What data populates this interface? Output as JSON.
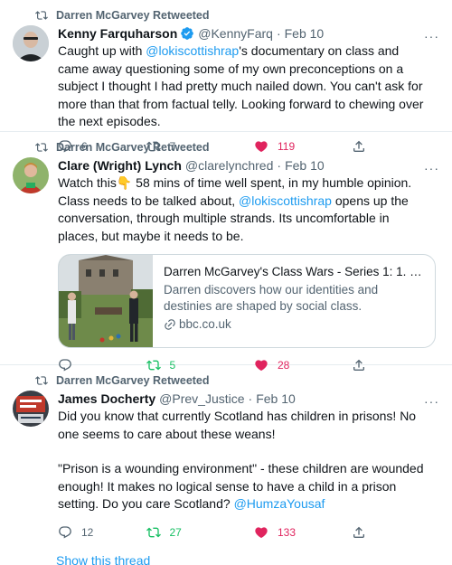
{
  "tweets": [
    {
      "retweet_label": "Darren McGarvey Retweeted",
      "name": "Kenny Farquharson",
      "handle": "@KennyFarq",
      "sep": "·",
      "date": "Feb 10",
      "more": "···",
      "text_a": "Caught up with ",
      "mention": "@lokiscottishrap",
      "text_b": "'s documentary on class and came away questioning some of my own preconceptions on a subject I thought I had pretty much nailed down. You can't ask for more than that from factual telly. Looking forward to chewing over the next episodes.",
      "replies": "6",
      "retweets": "7",
      "likes": "119"
    },
    {
      "retweet_label": "Darren McGarvey Retweeted",
      "name": "Clare (Wright) Lynch",
      "handle": "@clarelynchred",
      "sep": "·",
      "date": "Feb 10",
      "more": "···",
      "text_a": "Watch this👇 58 mins of time well spent, in my humble opinion. Class needs to be talked about, ",
      "mention": "@lokiscottishrap",
      "text_b": " opens up the conversation, through multiple strands. Its uncomfortable in places, but maybe it needs to be.",
      "card": {
        "title": "Darren McGarvey's Class Wars - Series 1: 1. Identi...",
        "description": "Darren discovers how our identities and destinies are shaped by social class.",
        "domain": "bbc.co.uk"
      },
      "retweets": "5",
      "likes": "28"
    },
    {
      "retweet_label": "Darren McGarvey Retweeted",
      "name": "James Docherty",
      "handle": "@Prev_Justice",
      "sep": "·",
      "date": "Feb 10",
      "more": "···",
      "text_p1": "Did you know that currently Scotland has children in prisons! No one seems to care about these weans!",
      "text_p2": "\"Prison is a wounding environment\" - these children are wounded enough! It makes no logical sense to have a child in a prison setting. Do you care Scotland? ",
      "mention": "@HumzaYousaf",
      "replies": "12",
      "retweets": "27",
      "likes": "133",
      "show_thread": "Show this thread"
    }
  ],
  "colors": {
    "link": "#1d9bf0",
    "like": "#e0245e",
    "retweeted": "#17bf63",
    "muted": "#536471"
  }
}
